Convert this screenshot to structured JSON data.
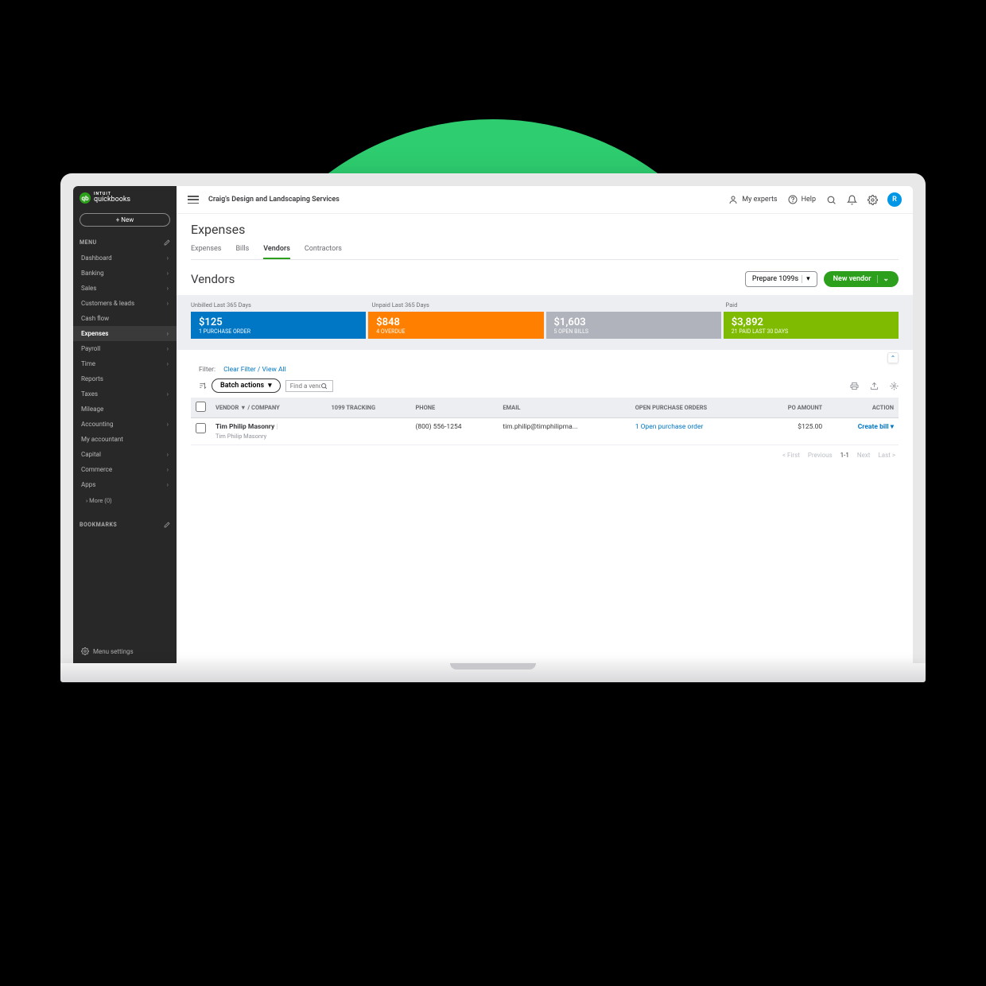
{
  "brand": {
    "intuit": "INTUIT",
    "name": "quickbooks",
    "logo_letter": "qb"
  },
  "sidebar": {
    "new_label": "+  New",
    "menu_label": "MENU",
    "bookmarks_label": "BOOKMARKS",
    "items": [
      {
        "label": "Dashboard",
        "has_children": true
      },
      {
        "label": "Banking",
        "has_children": true
      },
      {
        "label": "Sales",
        "has_children": true
      },
      {
        "label": "Customers & leads",
        "has_children": true
      },
      {
        "label": "Cash flow",
        "has_children": false
      },
      {
        "label": "Expenses",
        "has_children": true,
        "active": true
      },
      {
        "label": "Payroll",
        "has_children": true
      },
      {
        "label": "Time",
        "has_children": true
      },
      {
        "label": "Reports",
        "has_children": false
      },
      {
        "label": "Taxes",
        "has_children": true
      },
      {
        "label": "Mileage",
        "has_children": false
      },
      {
        "label": "Accounting",
        "has_children": true
      },
      {
        "label": "My accountant",
        "has_children": false
      },
      {
        "label": "Capital",
        "has_children": true
      },
      {
        "label": "Commerce",
        "has_children": true
      },
      {
        "label": "Apps",
        "has_children": true
      }
    ],
    "more": "More (0)",
    "settings": "Menu settings"
  },
  "topbar": {
    "company": "Craig's Design and Landscaping Services",
    "experts": "My experts",
    "help": "Help",
    "avatar": "R"
  },
  "page": {
    "title": "Expenses",
    "tabs": [
      "Expenses",
      "Bills",
      "Vendors",
      "Contractors"
    ],
    "active_tab": 2,
    "section_title": "Vendors",
    "prepare_1099s": "Prepare 1099s",
    "new_vendor": "New vendor"
  },
  "summary": {
    "segments": [
      {
        "label": "Unbilled Last 365 Days",
        "cards": [
          {
            "amount": "$125",
            "sub": "1 PURCHASE ORDER",
            "color": "blue"
          }
        ]
      },
      {
        "label": "Unpaid Last 365 Days",
        "cards": [
          {
            "amount": "$848",
            "sub": "4 OVERDUE",
            "color": "orange"
          },
          {
            "amount": "$1,603",
            "sub": "5 OPEN BILLS",
            "color": "gray"
          }
        ]
      },
      {
        "label": "Paid",
        "cards": [
          {
            "amount": "$3,892",
            "sub": "21 PAID LAST 30 DAYS",
            "color": "green"
          }
        ]
      }
    ]
  },
  "filter": {
    "label": "Filter:",
    "clear": "Clear Filter / View All",
    "batch": "Batch actions",
    "search_placeholder": "Find a vend"
  },
  "table": {
    "columns": {
      "vendor": "VENDOR ▼ / COMPANY",
      "tracking": "1099 TRACKING",
      "phone": "PHONE",
      "email": "EMAIL",
      "open_po": "OPEN PURCHASE ORDERS",
      "po_amount": "PO AMOUNT",
      "action": "ACTION"
    },
    "rows": [
      {
        "vendor": "Tim Philip Masonry",
        "company": "Tim Philip Masonry",
        "tracking": "",
        "phone": "(800) 556-1254",
        "email": "tim.philip@timphilipma...",
        "open_po": "1 Open purchase order",
        "po_amount": "$125.00",
        "action": "Create bill"
      }
    ]
  },
  "pagination": {
    "first": "< First",
    "prev": "Previous",
    "range": "1-1",
    "next": "Next",
    "last": "Last >"
  }
}
